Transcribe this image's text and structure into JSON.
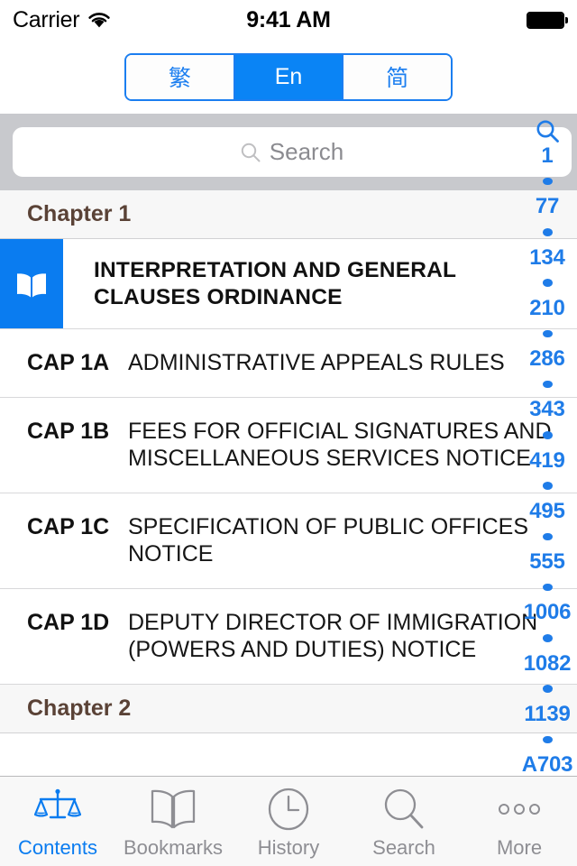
{
  "status_bar": {
    "carrier": "Carrier",
    "wifi_icon": "wifi-icon",
    "time": "9:41 AM",
    "battery_icon": "battery-full-icon"
  },
  "language_segmented_control": {
    "options": [
      {
        "label": "繁",
        "name": "traditional-chinese",
        "active": false
      },
      {
        "label": "En",
        "name": "english",
        "active": true
      },
      {
        "label": "简",
        "name": "simplified-chinese",
        "active": false
      }
    ],
    "selected": "En",
    "accent_color": "#0a84f5",
    "border_color": "#1b7ef0"
  },
  "search": {
    "placeholder": "Search",
    "value": "",
    "icon": "search-icon"
  },
  "index_strip": {
    "search_icon": "search-icon",
    "accent_color": "#1f7ce8",
    "entries": [
      "1",
      "77",
      "134",
      "210",
      "286",
      "343",
      "419",
      "495",
      "555",
      "1006",
      "1082",
      "1139",
      "A703"
    ]
  },
  "content": {
    "sections": [
      {
        "header": "Chapter 1",
        "featured": {
          "icon": "open-book-icon",
          "title": "INTERPRETATION AND GENERAL CLAUSES ORDINANCE",
          "badge_color": "#0a7cf0"
        },
        "rows": [
          {
            "cap": "CAP 1A",
            "title": "ADMINISTRATIVE APPEALS RULES"
          },
          {
            "cap": "CAP 1B",
            "title": "FEES FOR OFFICIAL SIGNATURES AND MISCELLANEOUS SERVICES NOTICE"
          },
          {
            "cap": "CAP 1C",
            "title": "SPECIFICATION OF PUBLIC OFFICES NOTICE"
          },
          {
            "cap": "CAP 1D",
            "title": "DEPUTY DIRECTOR OF IMMIGRATION (POWERS AND DUTIES) NOTICE"
          }
        ]
      },
      {
        "header": "Chapter 2",
        "rows": []
      }
    ],
    "header_text_color": "#5a4236"
  },
  "tab_bar": {
    "active_color": "#0a7cf0",
    "inactive_color": "#8e8e93",
    "tabs": [
      {
        "label": "Contents",
        "icon": "scales-of-justice-icon",
        "active": true
      },
      {
        "label": "Bookmarks",
        "icon": "open-book-icon",
        "active": false
      },
      {
        "label": "History",
        "icon": "clock-icon",
        "active": false
      },
      {
        "label": "Search",
        "icon": "search-icon",
        "active": false
      },
      {
        "label": "More",
        "icon": "ellipsis-icon",
        "active": false
      }
    ]
  }
}
